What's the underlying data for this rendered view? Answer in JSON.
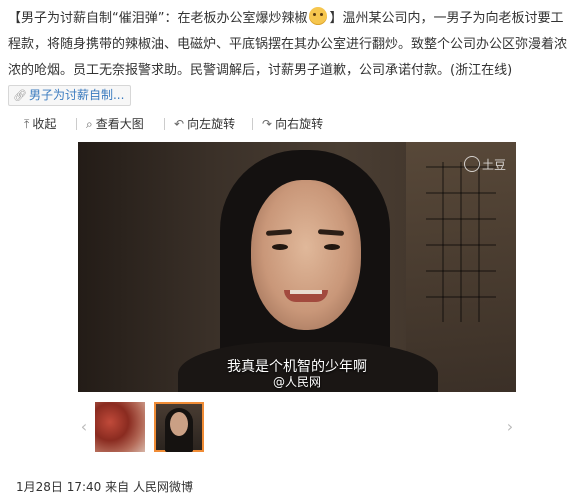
{
  "post": {
    "text_part1": "【男子为讨薪自制“催泪弹”：在老板办公室爆炒辣椒",
    "emoji_name": "cat-face-emoji",
    "text_part2": "】温州某公司内，一男子为向老板讨要工程款，将随身携带的辣椒油、电磁炉、平底锅摆在其办公室进行翻炒。致整个公司办公区弥漫着浓浓的呛烟。员工无奈报警求助。民警调解后，讨薪男子道歉，公司承诺付款。(浙江在线)",
    "link_tag": "男子为讨薪自制..."
  },
  "toolbar": {
    "collapse": "收起",
    "view_large": "查看大图",
    "rotate_left": "向左旋转",
    "rotate_right": "向右旋转"
  },
  "video": {
    "watermark": "土豆",
    "subtitle": "我真是个机智的少年啊",
    "credit": "@人民网"
  },
  "thumbnails": [
    {
      "name": "chili-image",
      "selected": false
    },
    {
      "name": "man-video-frame",
      "selected": true
    }
  ],
  "footer": {
    "date_time": "1月28日 17:40",
    "source_prefix": "来自",
    "source": "人民网微博"
  },
  "colors": {
    "link": "#3b7bbf",
    "selected_outline": "#f08c36"
  }
}
